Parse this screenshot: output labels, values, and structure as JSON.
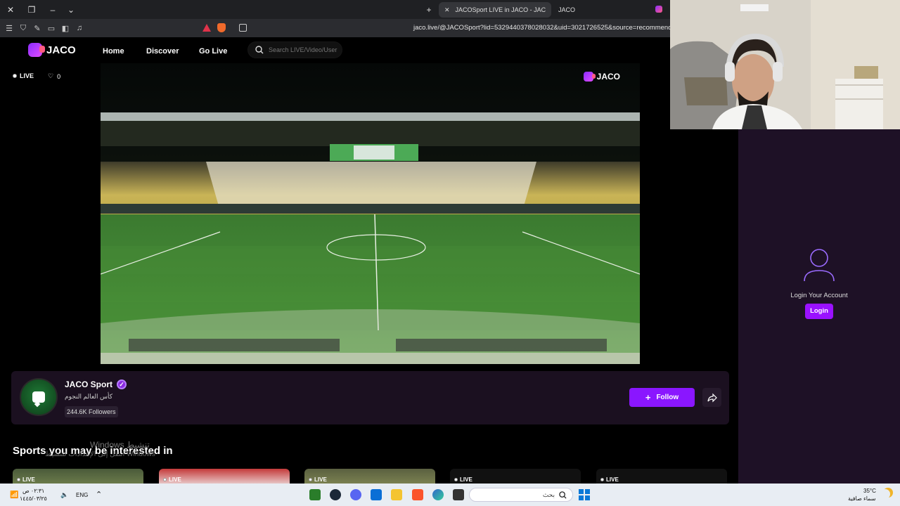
{
  "browser": {
    "tabs": [
      {
        "label": "JACOSport LIVE in JACO - JAC",
        "active": true
      },
      {
        "label": "JACO",
        "active": false
      }
    ],
    "url": "jaco.live/@JACOSport?lid=5329440378028032&uid=3021726525&source=recommend&"
  },
  "site": {
    "brand": "JACO",
    "nav": [
      "Home",
      "Discover",
      "Go Live"
    ],
    "search_placeholder": "Search LIVE/Video/User",
    "live_label": "LIVE",
    "likes": "0",
    "watermark": "JACO"
  },
  "streamer": {
    "name": "JACO Sport",
    "subtitle": "كأس العالم النجوم",
    "followers": "244.6K Followers",
    "follow_label": "Follow"
  },
  "section": {
    "title": "Sports you may be interested in",
    "thumb_live": "LIVE"
  },
  "windows_watermark": {
    "line1": "Windows تنشيط",
    "line2": "انتقل إلى الإعدادات لتنشيط Windows"
  },
  "login": {
    "text": "Login Your Account",
    "button": "Login"
  },
  "taskbar": {
    "date": "١٤٤٥/٠٣/٢٥",
    "time": "٠٢:٣١ ص",
    "lang": "ENG",
    "search": "بحث",
    "weather_temp": "35°C",
    "weather_desc": "سماء صافية"
  },
  "colors": {
    "accent": "#8a16ff",
    "panel": "#1e1126"
  }
}
